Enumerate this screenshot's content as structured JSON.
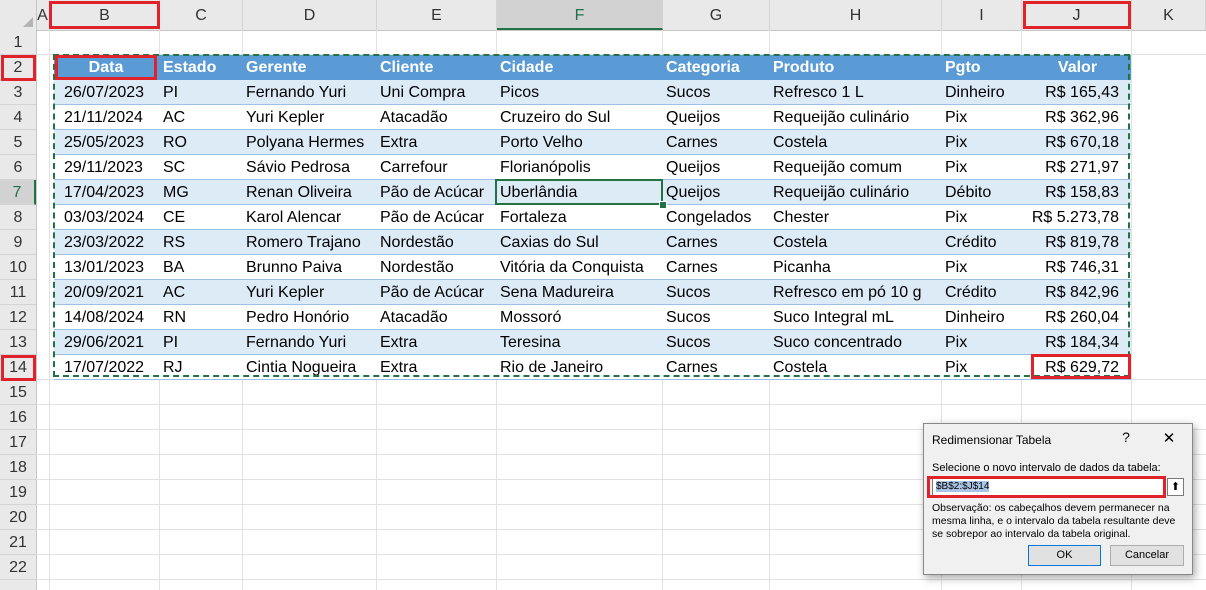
{
  "columns": [
    "A",
    "B",
    "C",
    "D",
    "E",
    "F",
    "G",
    "H",
    "I",
    "J",
    "K"
  ],
  "rows": [
    "1",
    "2",
    "3",
    "4",
    "5",
    "6",
    "7",
    "8",
    "9",
    "10",
    "11",
    "12",
    "13",
    "14",
    "15",
    "16",
    "17",
    "18",
    "19",
    "20",
    "21",
    "22"
  ],
  "table": {
    "headers": [
      "Data",
      "Estado",
      "Gerente",
      "Cliente",
      "Cidade",
      "Categoria",
      "Produto",
      "Pgto",
      "Valor"
    ],
    "rows": [
      [
        "26/07/2023",
        "PI",
        "Fernando Yuri",
        "Uni Compra",
        "Picos",
        "Sucos",
        "Refresco 1 L",
        "Dinheiro",
        "R$ 165,43"
      ],
      [
        "21/11/2024",
        "AC",
        "Yuri Kepler",
        "Atacadão",
        "Cruzeiro do Sul",
        "Queijos",
        "Requeijão culinário",
        "Pix",
        "R$ 362,96"
      ],
      [
        "25/05/2023",
        "RO",
        "Polyana Hermes",
        "Extra",
        "Porto Velho",
        "Carnes",
        "Costela",
        "Pix",
        "R$ 670,18"
      ],
      [
        "29/11/2023",
        "SC",
        "Sávio Pedrosa",
        "Carrefour",
        "Florianópolis",
        "Queijos",
        "Requeijão comum",
        "Pix",
        "R$ 271,97"
      ],
      [
        "17/04/2023",
        "MG",
        "Renan Oliveira",
        "Pão de Acúcar",
        "Uberlândia",
        "Queijos",
        "Requeijão culinário",
        "Débito",
        "R$ 158,83"
      ],
      [
        "03/03/2024",
        "CE",
        "Karol Alencar",
        "Pão de Acúcar",
        "Fortaleza",
        "Congelados",
        "Chester",
        "Pix",
        "R$ 5.273,78"
      ],
      [
        "23/03/2022",
        "RS",
        "Romero Trajano",
        "Nordestão",
        "Caxias do Sul",
        "Carnes",
        "Costela",
        "Crédito",
        "R$ 819,78"
      ],
      [
        "13/01/2023",
        "BA",
        "Brunno Paiva",
        "Nordestão",
        "Vitória da Conquista",
        "Carnes",
        "Picanha",
        "Pix",
        "R$ 746,31"
      ],
      [
        "20/09/2021",
        "AC",
        "Yuri Kepler",
        "Pão de Acúcar",
        "Sena Madureira",
        "Sucos",
        "Refresco em pó 10 g",
        "Crédito",
        "R$ 842,96"
      ],
      [
        "14/08/2024",
        "RN",
        "Pedro Honório",
        "Atacadão",
        "Mossoró",
        "Sucos",
        "Suco Integral mL",
        "Dinheiro",
        "R$ 260,04"
      ],
      [
        "29/06/2021",
        "PI",
        "Fernando Yuri",
        "Extra",
        "Teresina",
        "Sucos",
        "Suco concentrado",
        "Pix",
        "R$ 184,34"
      ],
      [
        "17/07/2022",
        "RJ",
        "Cintia Nogueira",
        "Extra",
        "Rio de Janeiro",
        "Carnes",
        "Costela",
        "Pix",
        "R$ 629,72"
      ]
    ]
  },
  "dialog": {
    "title": "Redimensionar Tabela",
    "help": "?",
    "close": "✕",
    "prompt": "Selecione o novo intervalo de dados da tabela:",
    "range_value": "$B$2:$J$14",
    "collapse_icon": "⬆",
    "note": "Observação: os cabeçalhos devem permanecer na mesma linha, e o intervalo da tabela resultante deve se sobrepor ao intervalo da tabela original.",
    "ok_label": "OK",
    "cancel_label": "Cancelar"
  },
  "colors": {
    "header_fill": "#5b9bd5",
    "band_fill": "#ddebf7",
    "excel_green": "#217346",
    "highlight_red": "#e0222a"
  }
}
